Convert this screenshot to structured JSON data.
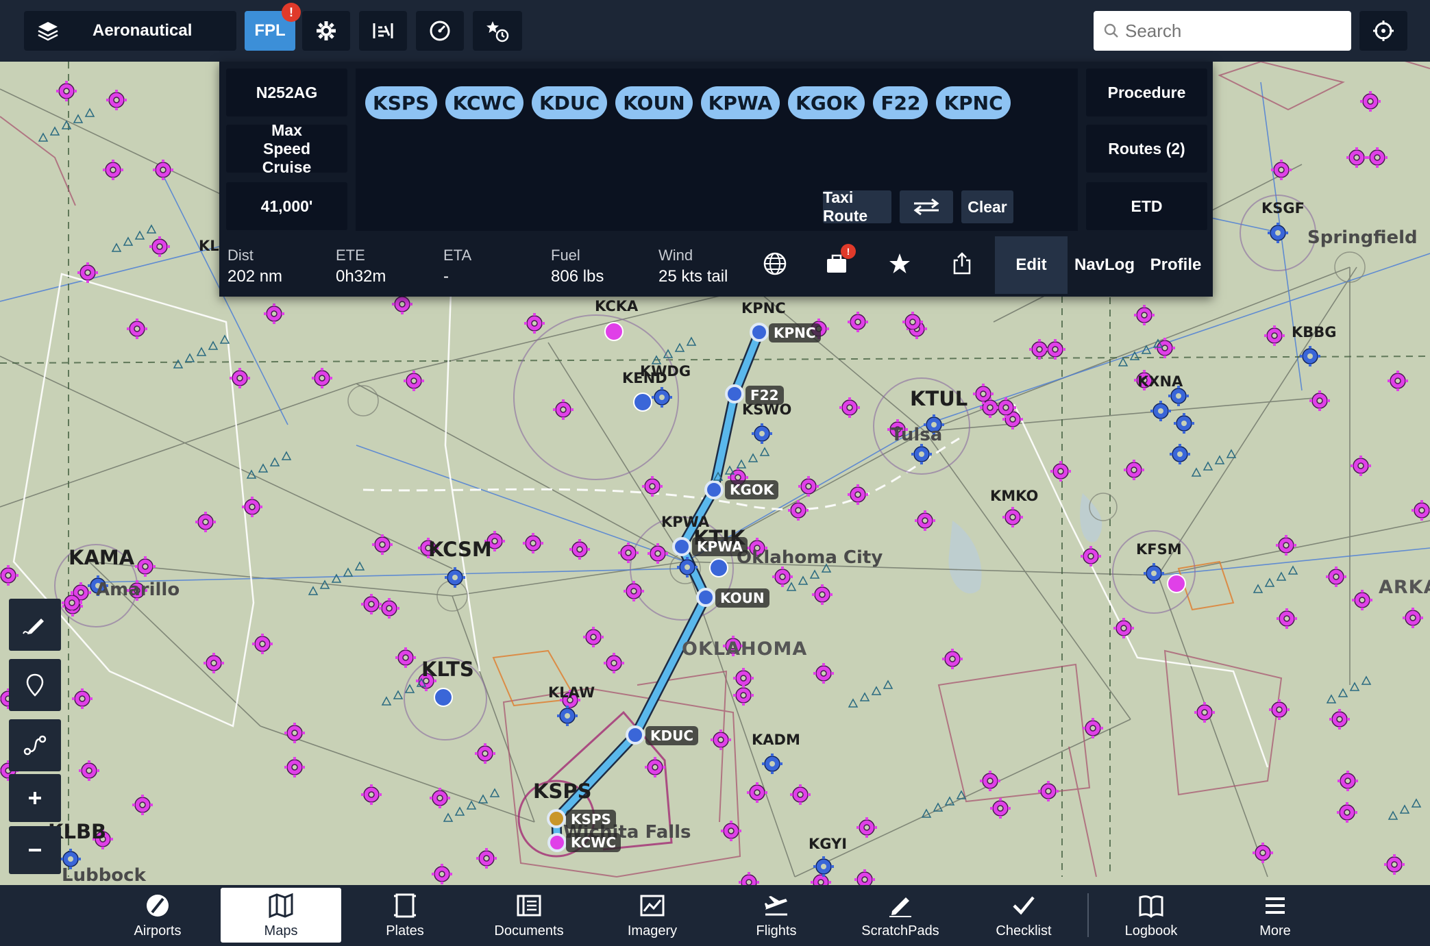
{
  "topbar": {
    "layers_label": "Aeronautical",
    "fpl_label": "FPL",
    "fpl_badge": "!",
    "search_placeholder": "Search"
  },
  "flight_plan": {
    "aircraft": "N252AG",
    "speed_mode": "Max Speed Cruise",
    "altitude": "41,000'",
    "waypoints": [
      "KSPS",
      "KCWC",
      "KDUC",
      "KOUN",
      "KPWA",
      "KGOK",
      "F22",
      "KPNC"
    ],
    "buttons": {
      "taxi_route": "Taxi Route",
      "clear": "Clear",
      "procedure": "Procedure",
      "routes": "Routes (2)",
      "etd": "ETD"
    },
    "stats": [
      {
        "label": "Dist",
        "value": "202 nm"
      },
      {
        "label": "ETE",
        "value": "0h32m"
      },
      {
        "label": "ETA",
        "value": "-"
      },
      {
        "label": "Fuel",
        "value": "806 lbs"
      },
      {
        "label": "Wind",
        "value": "25 kts tail"
      }
    ],
    "tabs": {
      "edit": "Edit",
      "navlog": "NavLog",
      "profile": "Profile"
    },
    "icons": [
      "globe-icon",
      "briefcase-icon",
      "star-icon",
      "share-icon"
    ],
    "briefcase_badge": "!"
  },
  "map": {
    "airport_labels": [
      {
        "t": "KAMA"
      },
      {
        "t": "KCSM"
      },
      {
        "t": "KLTS"
      },
      {
        "t": "KLBB"
      },
      {
        "t": "KTUL"
      },
      {
        "t": "KSPS"
      },
      {
        "t": "KTIK"
      }
    ],
    "small_labels": [
      {
        "t": "KCKA"
      },
      {
        "t": "KPNC"
      },
      {
        "t": "KWDG"
      },
      {
        "t": "KEND"
      },
      {
        "t": "KSWO"
      },
      {
        "t": "KMKO"
      },
      {
        "t": "KFSM"
      },
      {
        "t": "KSGF"
      },
      {
        "t": "KBBG"
      },
      {
        "t": "KXNA"
      },
      {
        "t": "KLAW"
      },
      {
        "t": "KADM"
      },
      {
        "t": "KGYI"
      },
      {
        "t": "KPWA"
      },
      {
        "t": "KL"
      }
    ],
    "city_labels": [
      {
        "t": "Oklahoma City"
      },
      {
        "t": "Tulsa"
      },
      {
        "t": "Springfield"
      },
      {
        "t": "Lubbock"
      },
      {
        "t": "Wichita Falls"
      },
      {
        "t": "Amarillo"
      }
    ],
    "state_labels": [
      {
        "t": "OKLAHOMA"
      },
      {
        "t": "ARKA"
      }
    ],
    "route_tags": [
      {
        "t": "KPNC"
      },
      {
        "t": "F22"
      },
      {
        "t": "KGOK"
      },
      {
        "t": "KPWA"
      },
      {
        "t": "KOUN"
      },
      {
        "t": "KDUC"
      },
      {
        "t": "KSPS"
      },
      {
        "t": "KCWC"
      }
    ],
    "colors": {
      "route": "#5ab8ec",
      "airport_magenta": "#e040e8",
      "towered_blue": "#3a66d8"
    }
  },
  "left_tools": [
    "draw-icon",
    "pin-icon",
    "route-icon",
    "zoom-in-icon",
    "zoom-out-icon"
  ],
  "bottom_nav": [
    {
      "label": "Airports"
    },
    {
      "label": "Maps"
    },
    {
      "label": "Plates"
    },
    {
      "label": "Documents"
    },
    {
      "label": "Imagery"
    },
    {
      "label": "Flights"
    },
    {
      "label": "ScratchPads"
    },
    {
      "label": "Checklist"
    },
    {
      "label": "Logbook"
    },
    {
      "label": "More"
    }
  ]
}
